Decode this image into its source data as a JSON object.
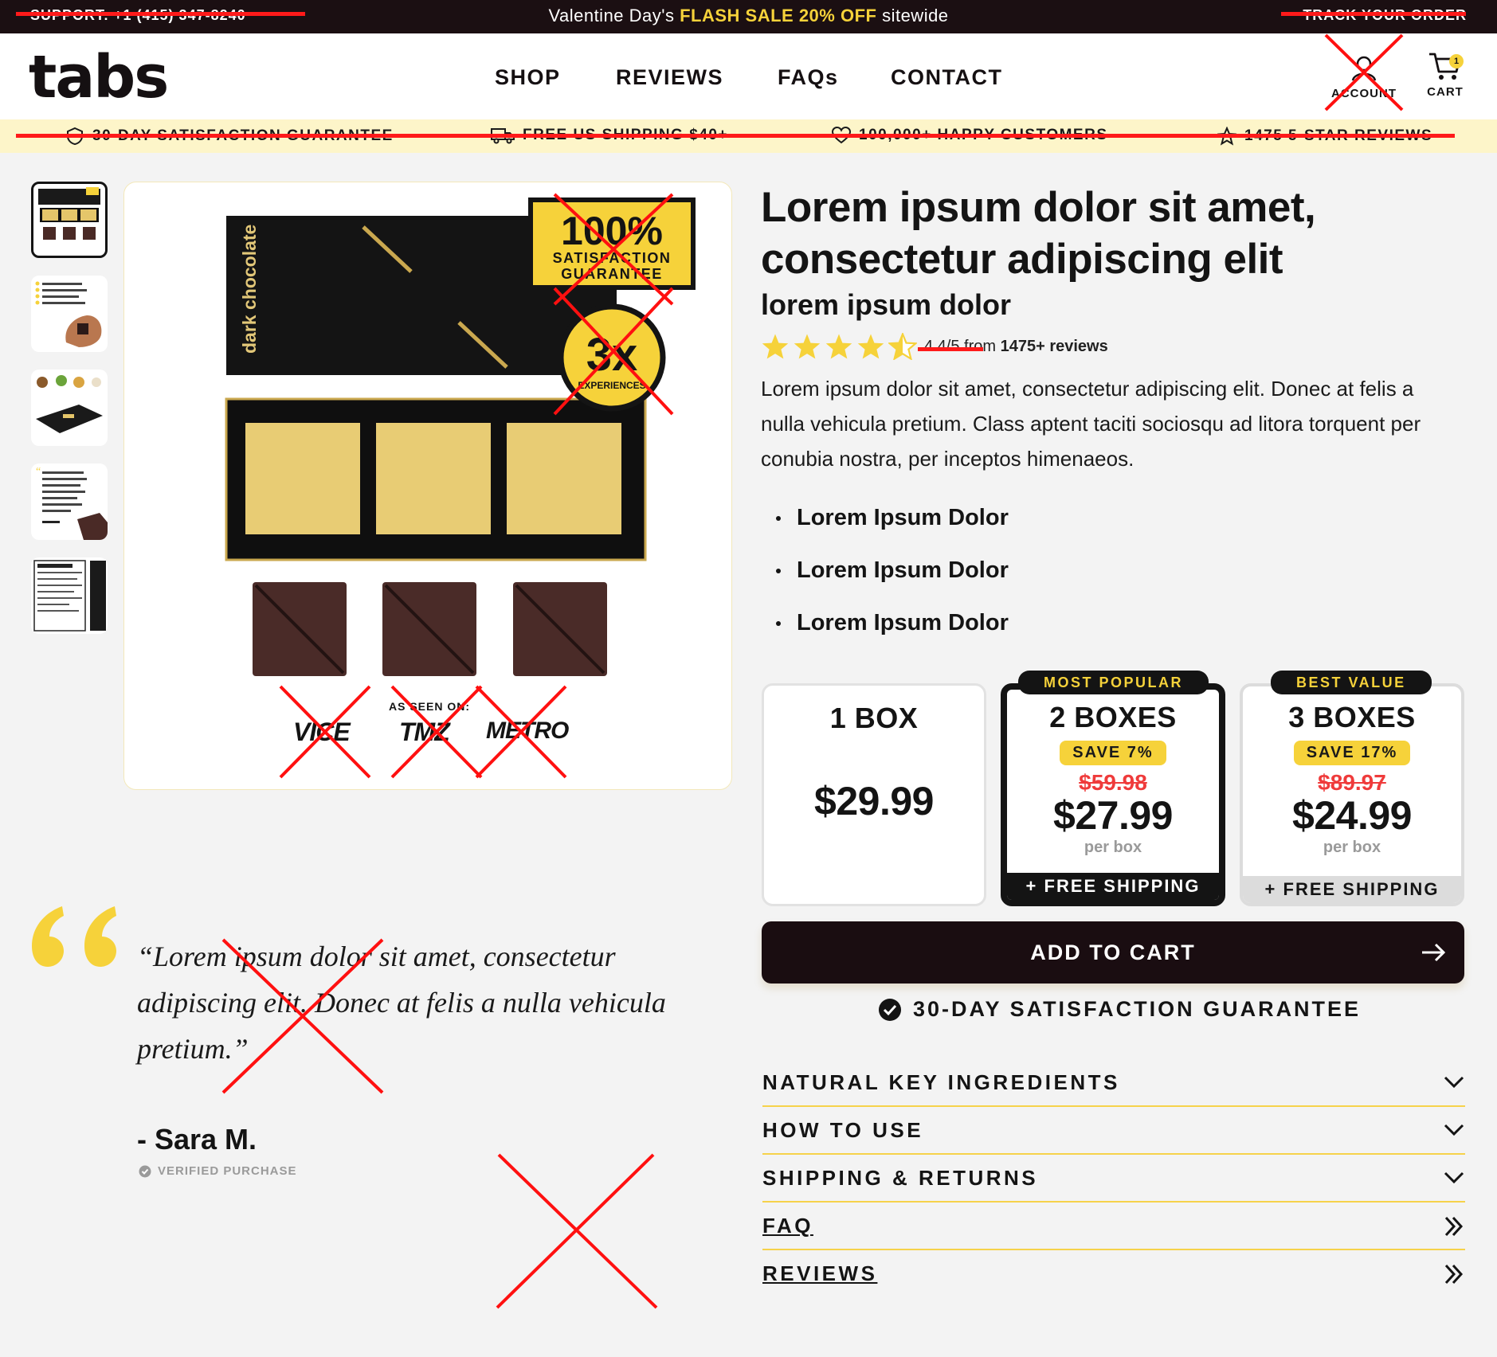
{
  "topbar": {
    "support": "SUPPORT: +1 (415) 347-8240",
    "announce_pre": "Valentine Day's ",
    "announce_highlight": "FLASH SALE 20% OFF",
    "announce_post": " sitewide",
    "track_order": "TRACK YOUR ORDER"
  },
  "header": {
    "logo": "tabs",
    "nav": [
      "SHOP",
      "REVIEWS",
      "FAQs",
      "CONTACT"
    ],
    "account_label": "ACCOUNT",
    "cart_label": "CART",
    "cart_count": "1"
  },
  "trustbar": [
    {
      "icon": "shield-icon",
      "label": "30-DAY SATISFACTION GUARANTEE"
    },
    {
      "icon": "truck-icon",
      "label": "FREE US SHIPPING $40+"
    },
    {
      "icon": "heart-icon",
      "label": "100,000+ HAPPY CUSTOMERS"
    },
    {
      "icon": "star-icon",
      "label": "1475 5-STAR REVIEWS"
    }
  ],
  "gallery": {
    "box_label": "dark chocolate",
    "badge_big": "100%",
    "badge_small1": "SATISFACTION",
    "badge_small2": "GUARANTEE",
    "seal_big": "3x",
    "seal_small": "EXPERIENCES",
    "as_seen": "AS SEEN ON:",
    "press": [
      "VICE",
      "TMZ",
      "METRO"
    ]
  },
  "product": {
    "title": "Lorem ipsum dolor sit amet, consectetur adipiscing elit",
    "subtitle": "lorem ipsum dolor",
    "rating_value": "4.4/5",
    "rating_from": " from ",
    "rating_count": "1475+ reviews",
    "description": "Lorem ipsum dolor sit amet, consectetur adipiscing elit. Donec at felis a nulla vehicula pretium. Class aptent taciti sociosqu ad litora torquent per conubia nostra, per inceptos himenaeos.",
    "bullets": [
      "Lorem Ipsum Dolor",
      "Lorem Ipsum Dolor",
      "Lorem Ipsum Dolor"
    ]
  },
  "offers": [
    {
      "qty": "1 BOX",
      "price": "$29.99"
    },
    {
      "tag": "MOST POPULAR",
      "qty": "2 BOXES",
      "save": "SAVE 7%",
      "strike": "$59.98",
      "price": "$27.99",
      "per": "per box",
      "shipping": "+ FREE SHIPPING"
    },
    {
      "tag": "BEST VALUE",
      "qty": "3 BOXES",
      "save": "SAVE 17%",
      "strike": "$89.97",
      "price": "$24.99",
      "per": "per box",
      "shipping": "+ FREE SHIPPING"
    }
  ],
  "cta": {
    "add_to_cart": "ADD TO CART",
    "guarantee": "30-DAY SATISFACTION GUARANTEE"
  },
  "accordion": [
    "NATURAL KEY INGREDIENTS",
    "HOW TO USE",
    "SHIPPING & RETURNS",
    "FAQ",
    "REVIEWS"
  ],
  "testimonial": {
    "quote": "“Lorem ipsum dolor sit amet, consectetur adipiscing elit. Donec at felis a nulla vehicula pretium.”",
    "author": "- Sara M.",
    "verified": "VERIFIED PURCHASE"
  },
  "colors": {
    "accent": "#f6d23a",
    "dark": "#1b0f12",
    "trust_bg": "#fdf5c9",
    "strike": "#ef3b3b",
    "annotation": "#ff1010"
  }
}
